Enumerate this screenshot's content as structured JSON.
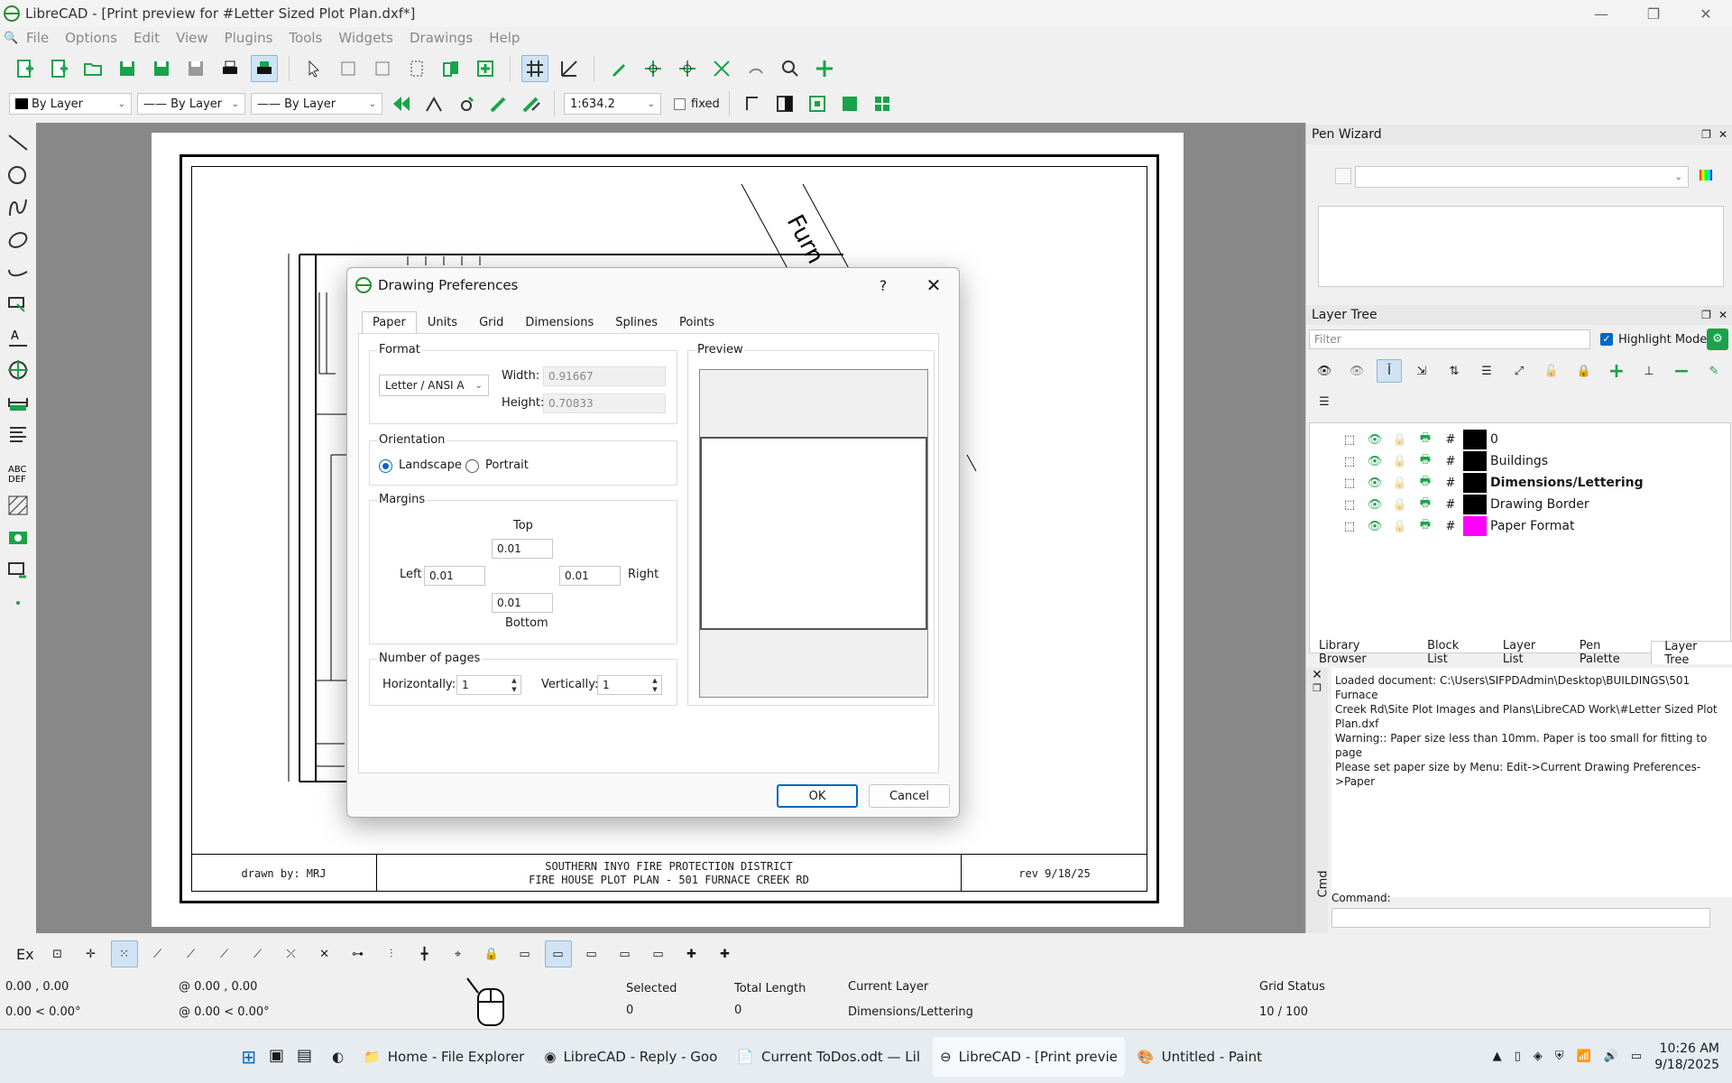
{
  "window": {
    "title": "LibreCAD - [Print preview for #Letter Sized Plot Plan.dxf*]",
    "min": "—",
    "max": "❐",
    "close": "✕"
  },
  "menu": [
    "File",
    "Options",
    "Edit",
    "View",
    "Plugins",
    "Tools",
    "Widgets",
    "Drawings",
    "Help"
  ],
  "props": {
    "color": "By Layer",
    "linetype": "By Layer",
    "width": "By Layer",
    "scale": "1:634.2",
    "fixed_label": "fixed"
  },
  "drawing": {
    "label_furn": "Furn",
    "titleblock": {
      "drawn_by": "drawn by: MRJ",
      "line1": "SOUTHERN INYO FIRE PROTECTION DISTRICT",
      "line2": "FIRE HOUSE PLOT PLAN - 501 FURNACE CREEK RD",
      "rev": "rev 9/18/25"
    }
  },
  "dialog": {
    "title": "Drawing Preferences",
    "help": "?",
    "close": "✕",
    "tabs": [
      "Paper",
      "Units",
      "Grid",
      "Dimensions",
      "Splines",
      "Points"
    ],
    "format": {
      "group": "Format",
      "paper": "Letter / ANSI A",
      "width_label": "Width:",
      "width": "0.91667",
      "height_label": "Height:",
      "height": "0.70833"
    },
    "orientation": {
      "group": "Orientation",
      "landscape": "Landscape",
      "portrait": "Portrait",
      "selected": "Landscape"
    },
    "margins": {
      "group": "Margins",
      "top_label": "Top",
      "top": "0.01",
      "left_label": "Left",
      "left": "0.01",
      "right_label": "Right",
      "right": "0.01",
      "bottom_label": "Bottom",
      "bottom": "0.01"
    },
    "pages": {
      "group": "Number of pages",
      "h_label": "Horizontally:",
      "h": "1",
      "v_label": "Vertically:",
      "v": "1"
    },
    "preview": {
      "group": "Preview"
    },
    "ok": "OK",
    "cancel": "Cancel"
  },
  "pen_wizard": {
    "title": "Pen Wizard"
  },
  "layer_tree": {
    "title": "Layer Tree",
    "filter_placeholder": "Filter",
    "highlight_mode": "Highlight Mode",
    "layers": [
      {
        "name": "0",
        "color": "#000000",
        "bold": false
      },
      {
        "name": "Buildings",
        "color": "#000000",
        "bold": false
      },
      {
        "name": "Dimensions/Lettering",
        "color": "#000000",
        "bold": true
      },
      {
        "name": "Drawing Border",
        "color": "#000000",
        "bold": false
      },
      {
        "name": "Paper Format",
        "color": "#ff00ff",
        "bold": false
      }
    ]
  },
  "bottom_tabs": [
    "Library Browser",
    "Block List",
    "Layer List",
    "Pen Palette",
    "Layer Tree"
  ],
  "cmd": {
    "side_label": "Cmd",
    "log": [
      "Loaded document: C:\\Users\\SIFPDAdmin\\Desktop\\BUILDINGS\\501 Furnace",
      "Creek Rd\\Site Plot Images and Plans\\LibreCAD Work\\#Letter Sized Plot",
      "Plan.dxf",
      "Warning:: Paper size less than 10mm. Paper is too small for fitting to page",
      "Please set paper size by Menu: Edit->Current Drawing Preferences->Paper"
    ],
    "command_label": "Command:"
  },
  "status": {
    "abs_xy": "0.00 , 0.00",
    "abs_polar": "0.00 < 0.00°",
    "rel_xy": "@  0.00 , 0.00",
    "rel_polar": "@  0.00 < 0.00°",
    "selected_label": "Selected",
    "selected": "0",
    "total_length_label": "Total Length",
    "total_length": "0",
    "current_layer_label": "Current Layer",
    "current_layer": "Dimensions/Lettering",
    "grid_status_label": "Grid Status",
    "grid_status": "10 / 100"
  },
  "snap_ex": "Ex",
  "taskbar": {
    "items": [
      {
        "label": "Home - File Explorer",
        "active": false
      },
      {
        "label": "LibreCAD - Reply - Goo",
        "active": false
      },
      {
        "label": "Current ToDos.odt — Lil",
        "active": false
      },
      {
        "label": "LibreCAD - [Print previe",
        "active": true
      },
      {
        "label": "Untitled - Paint",
        "active": false
      }
    ],
    "time": "10:26 AM",
    "date": "9/18/2025"
  },
  "colors": {
    "accent": "#0067c0",
    "green_icon": "#1aa34a",
    "canvas_gray": "#888888"
  }
}
